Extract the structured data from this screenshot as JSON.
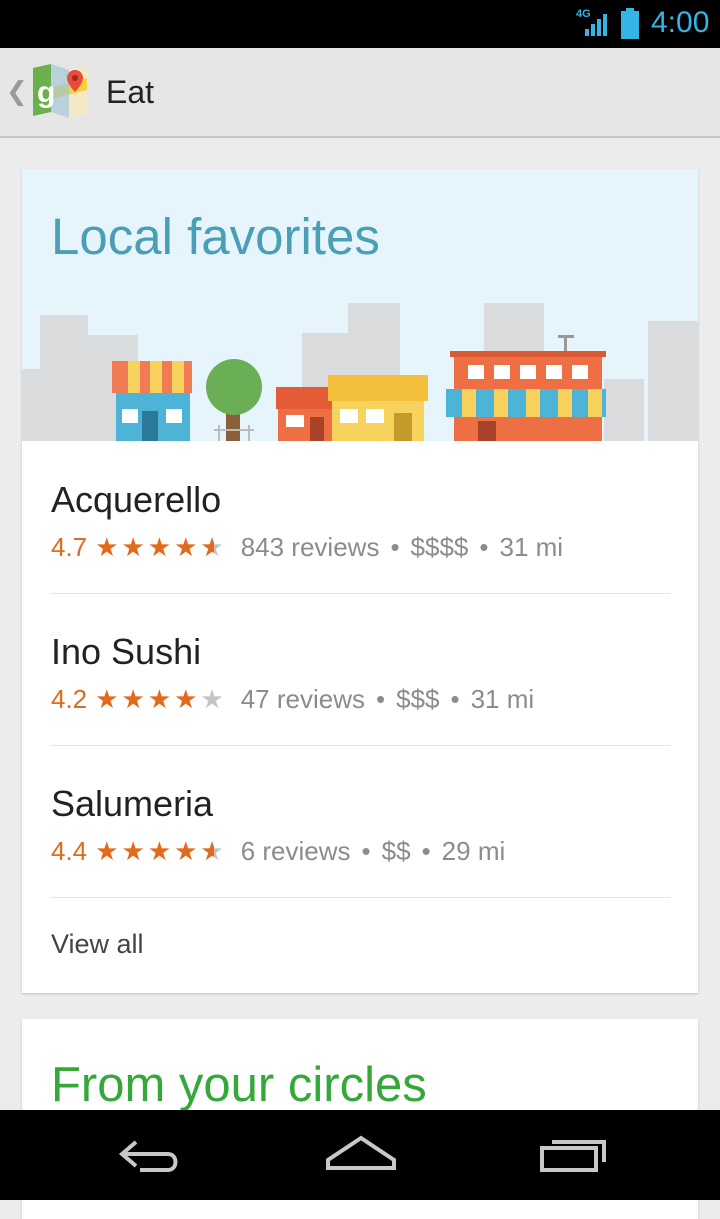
{
  "status_bar": {
    "network": "4G",
    "time": "4:00"
  },
  "action_bar": {
    "title": "Eat"
  },
  "card": {
    "heading": "Local favorites",
    "places": [
      {
        "name": "Acquerello",
        "rating": "4.7",
        "stars_value": 4.5,
        "reviews": "843 reviews",
        "price": "$$$$",
        "distance": "31 mi"
      },
      {
        "name": "Ino Sushi",
        "rating": "4.2",
        "stars_value": 4.0,
        "reviews": "47 reviews",
        "price": "$$$",
        "distance": "31 mi"
      },
      {
        "name": "Salumeria",
        "rating": "4.4",
        "stars_value": 4.5,
        "reviews": "6 reviews",
        "price": "$$",
        "distance": "29 mi"
      }
    ],
    "view_all": "View all"
  },
  "card2": {
    "heading": "From your circles"
  },
  "colors": {
    "accent_blue": "#4a9fb6",
    "rating_orange": "#e36a1b",
    "circles_green": "#35a83a",
    "status_blue": "#33b5e5"
  },
  "icons": {
    "back": "back-icon",
    "home": "home-icon",
    "recents": "recents-icon",
    "maps": "maps-app-icon"
  }
}
